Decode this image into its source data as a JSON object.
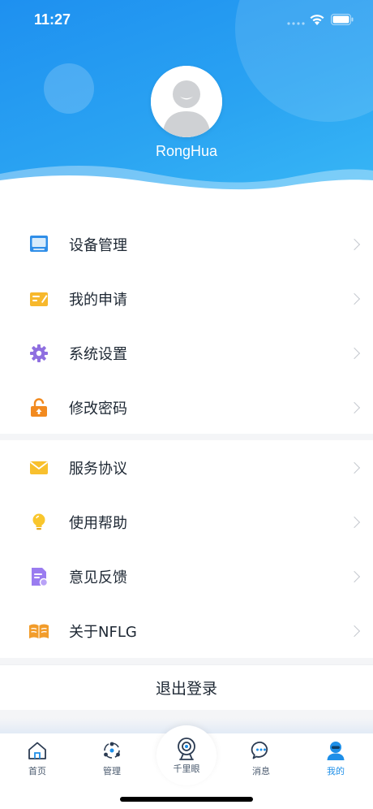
{
  "status_bar": {
    "time": "11:27"
  },
  "profile": {
    "username": "RongHua"
  },
  "menu_group_1": [
    {
      "label": "设备管理",
      "icon": "device-monitor-icon"
    },
    {
      "label": "我的申请",
      "icon": "application-card-icon"
    },
    {
      "label": "系统设置",
      "icon": "settings-gear-icon"
    },
    {
      "label": "修改密码",
      "icon": "lock-icon"
    }
  ],
  "menu_group_2": [
    {
      "label": "服务协议",
      "icon": "envelope-icon"
    },
    {
      "label": "使用帮助",
      "icon": "lightbulb-icon"
    },
    {
      "label": "意见反馈",
      "icon": "feedback-document-icon"
    },
    {
      "label": "关于NFLG",
      "icon": "book-icon"
    }
  ],
  "logout_label": "退出登录",
  "tabbar": {
    "tabs": [
      {
        "label": "首页",
        "icon": "home-icon"
      },
      {
        "label": "管理",
        "icon": "manage-icon"
      },
      {
        "label": "千里眼",
        "icon": "camera-icon"
      },
      {
        "label": "消息",
        "icon": "message-icon"
      },
      {
        "label": "我的",
        "icon": "profile-icon"
      }
    ],
    "active_index": 4
  },
  "colors": {
    "header_blue": "#1e90f0",
    "active_tab": "#1e8fe8",
    "text": "#1d2733"
  }
}
